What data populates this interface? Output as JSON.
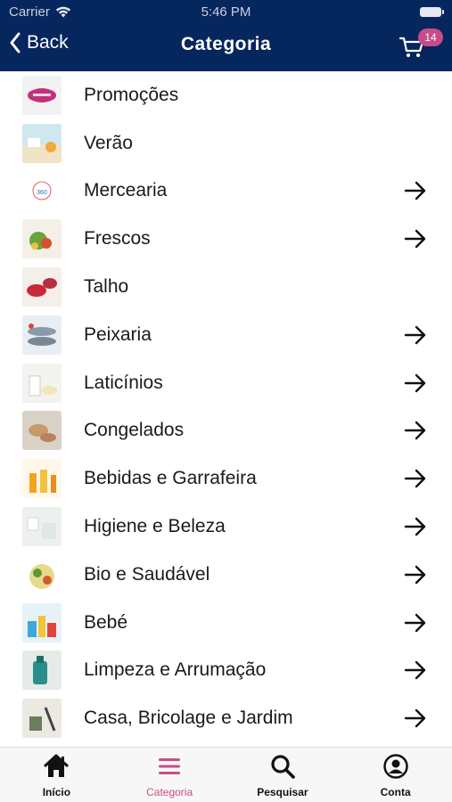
{
  "status_bar": {
    "carrier": "Carrier",
    "time": "5:46 PM"
  },
  "nav": {
    "back_label": "Back",
    "title": "Categoria",
    "cart_count": "14"
  },
  "colors": {
    "header": "#06265e",
    "accent": "#c94c86",
    "text": "#1a1a1a"
  },
  "categories": [
    {
      "label": "Promoções",
      "has_arrow": false,
      "thumb": "promo"
    },
    {
      "label": "Verão",
      "has_arrow": false,
      "thumb": "summer"
    },
    {
      "label": "Mercearia",
      "has_arrow": true,
      "thumb": "grocery"
    },
    {
      "label": "Frescos",
      "has_arrow": true,
      "thumb": "fresh"
    },
    {
      "label": "Talho",
      "has_arrow": false,
      "thumb": "butcher"
    },
    {
      "label": "Peixaria",
      "has_arrow": true,
      "thumb": "fish"
    },
    {
      "label": "Laticínios",
      "has_arrow": true,
      "thumb": "dairy"
    },
    {
      "label": "Congelados",
      "has_arrow": true,
      "thumb": "frozen"
    },
    {
      "label": "Bebidas e Garrafeira",
      "has_arrow": true,
      "thumb": "drinks"
    },
    {
      "label": "Higiene e Beleza",
      "has_arrow": true,
      "thumb": "hygiene"
    },
    {
      "label": "Bio e Saudável",
      "has_arrow": true,
      "thumb": "bio"
    },
    {
      "label": "Bebé",
      "has_arrow": true,
      "thumb": "baby"
    },
    {
      "label": "Limpeza e Arrumação",
      "has_arrow": true,
      "thumb": "cleaning"
    },
    {
      "label": "Casa, Bricolage e Jardim",
      "has_arrow": true,
      "thumb": "home"
    }
  ],
  "tabs": [
    {
      "label": "Início",
      "icon": "home-icon",
      "active": false
    },
    {
      "label": "Categoria",
      "icon": "menu-icon",
      "active": true
    },
    {
      "label": "Pesquisar",
      "icon": "search-icon",
      "active": false
    },
    {
      "label": "Conta",
      "icon": "account-icon",
      "active": false
    }
  ]
}
